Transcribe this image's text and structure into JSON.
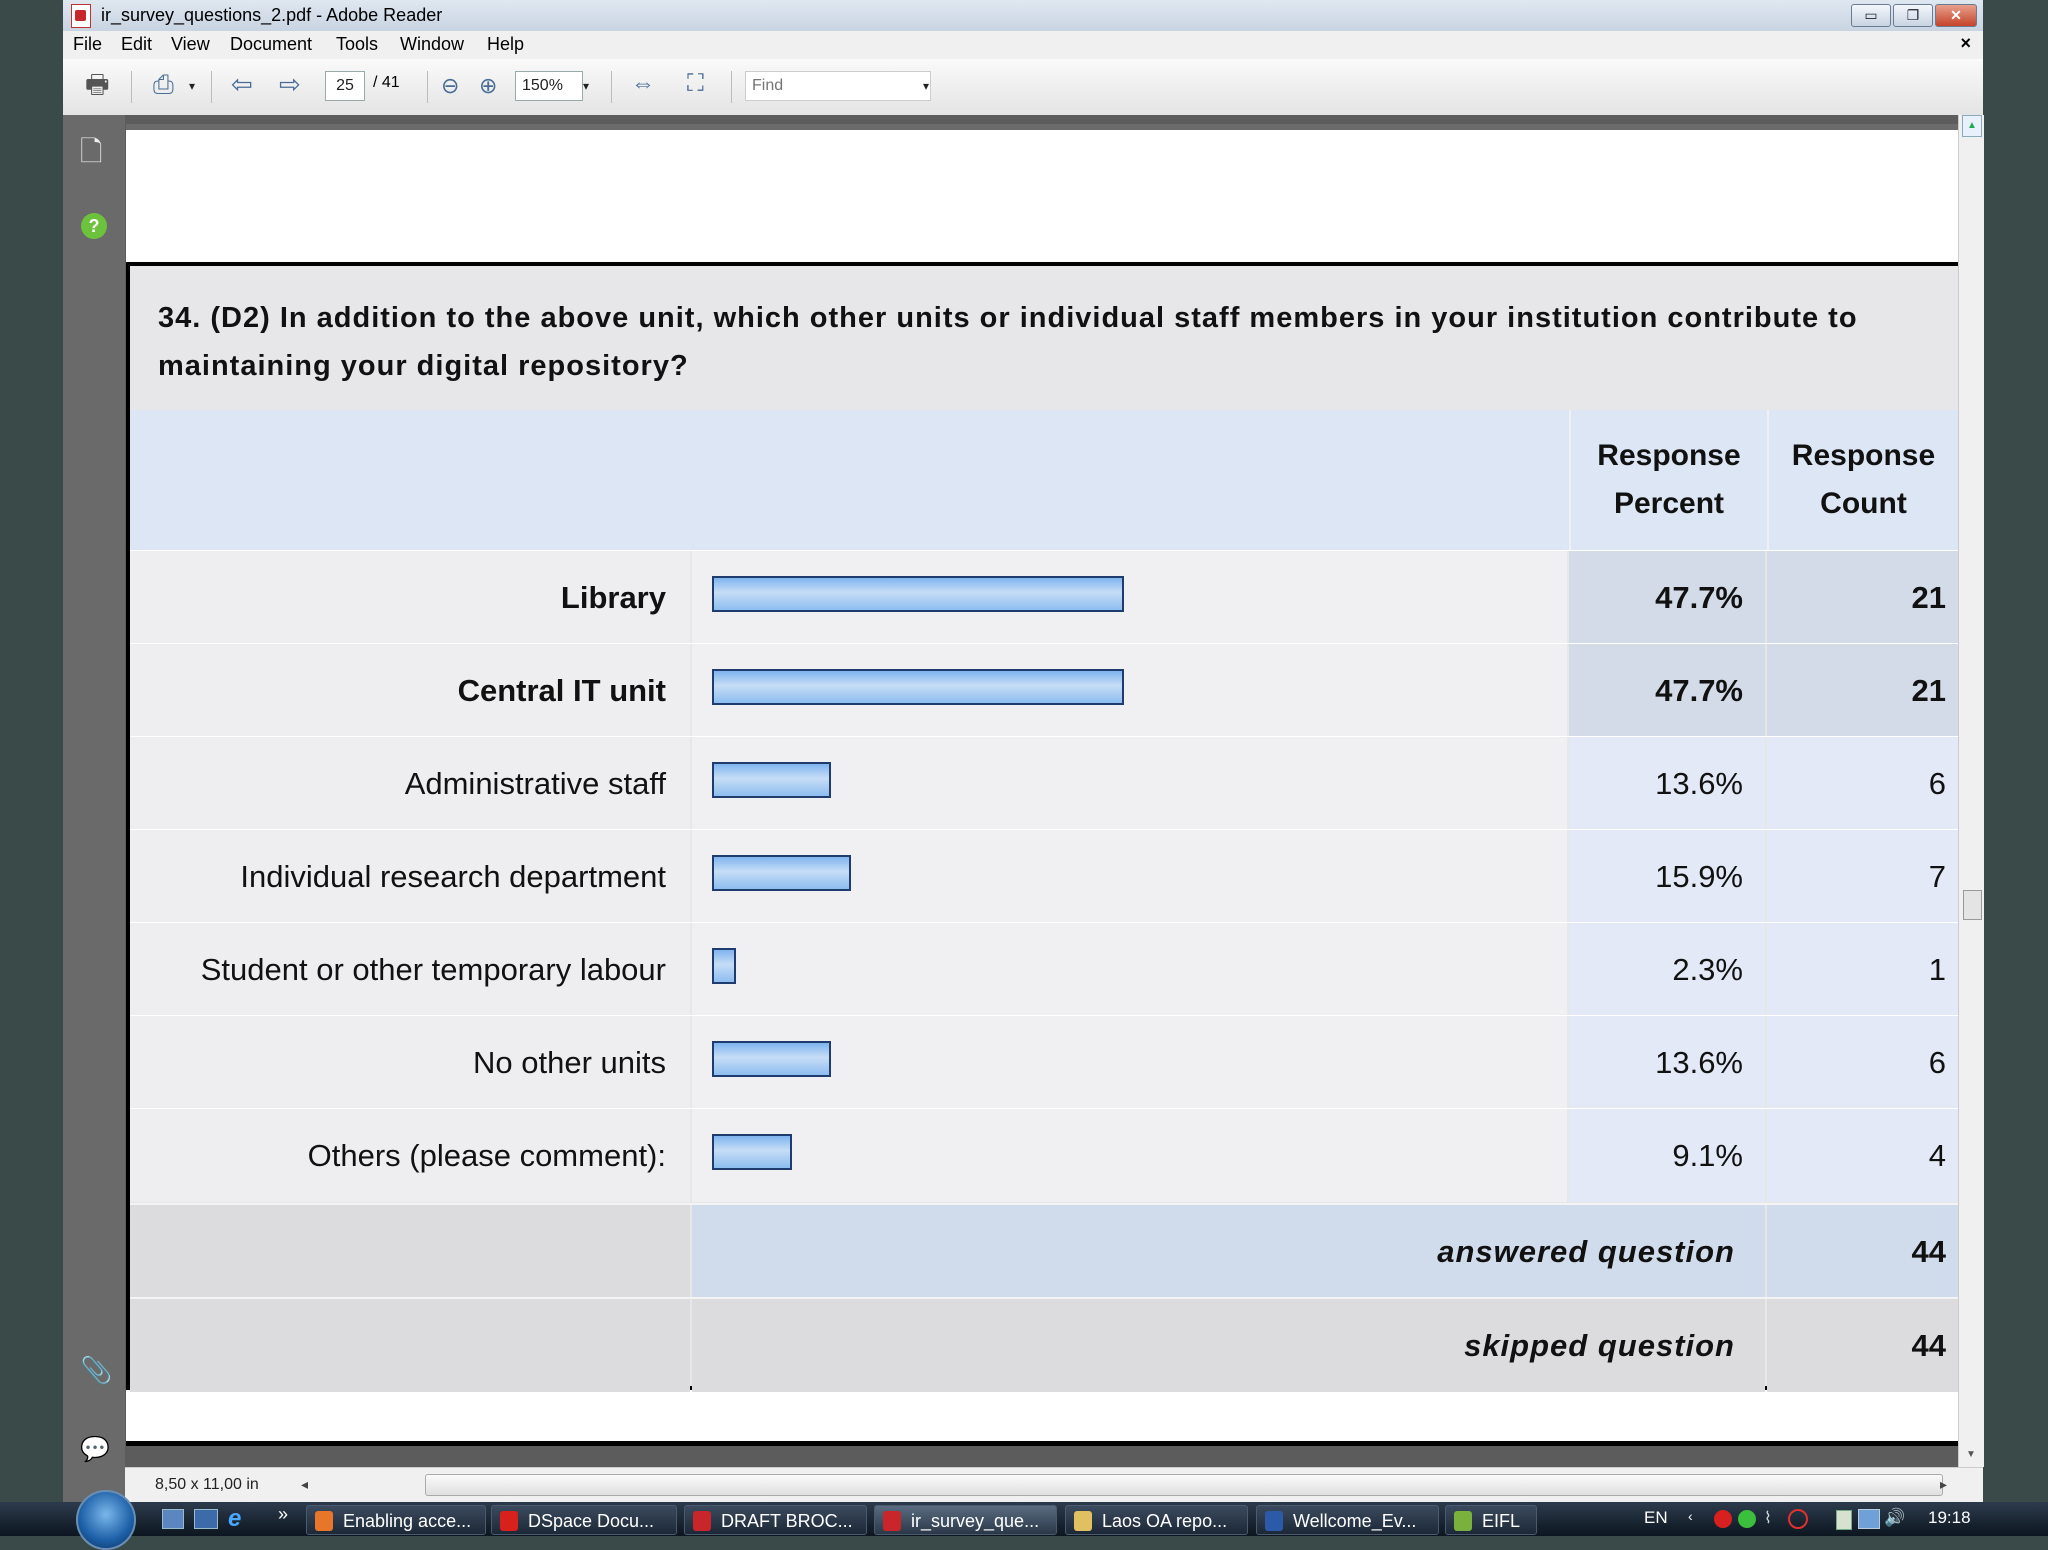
{
  "window": {
    "title": "ir_survey_questions_2.pdf - Adobe Reader",
    "minimize": "▭",
    "restore": "❐",
    "close": "✕"
  },
  "menu": [
    "File",
    "Edit",
    "View",
    "Document",
    "Tools",
    "Window",
    "Help"
  ],
  "menu_close": "×",
  "toolbar": {
    "page_current": "25",
    "page_total": "/ 41",
    "zoom": "150%",
    "find_placeholder": "Find"
  },
  "status": {
    "page_size": "8,50 x 11,00 in"
  },
  "question": "34. (D2) In addition to the above unit, which other units or individual staff members in your institution contribute to maintaining your digital repository?",
  "table": {
    "header_percent": "Response Percent",
    "header_count": "Response Count",
    "rows": [
      {
        "label": "Library",
        "percent": "47.7%",
        "count": "21",
        "bold": true
      },
      {
        "label": "Central IT unit",
        "percent": "47.7%",
        "count": "21",
        "bold": true
      },
      {
        "label": "Administrative staff",
        "percent": "13.6%",
        "count": "6",
        "bold": false
      },
      {
        "label": "Individual research department",
        "percent": "15.9%",
        "count": "7",
        "bold": false
      },
      {
        "label": "Student or other temporary labour",
        "percent": "2.3%",
        "count": "1",
        "bold": false
      },
      {
        "label": "No other units",
        "percent": "13.6%",
        "count": "6",
        "bold": false
      },
      {
        "label": "Others (please comment):",
        "percent": "9.1%",
        "count": "4",
        "bold": false
      }
    ],
    "answered_label": "answered question",
    "answered_count": "44",
    "skipped_label": "skipped question",
    "skipped_count": "44"
  },
  "chart_data": {
    "type": "bar",
    "categories": [
      "Library",
      "Central IT unit",
      "Administrative staff",
      "Individual research department",
      "Student or other temporary labour",
      "No other units",
      "Others (please comment):"
    ],
    "values": [
      47.7,
      47.7,
      13.6,
      15.9,
      2.3,
      13.6,
      9.1
    ],
    "counts": [
      21,
      21,
      6,
      7,
      1,
      6,
      4
    ],
    "orientation": "horizontal",
    "title": "34. (D2) In addition to the above unit, which other units or individual staff members in your institution contribute to maintaining your digital repository?",
    "xlim": [
      0,
      100
    ]
  },
  "taskbar": {
    "buttons": [
      {
        "label": "Enabling acce...",
        "icon": "firefox-icon",
        "color": "#e8762a"
      },
      {
        "label": "DSpace Docu...",
        "icon": "opera-icon",
        "color": "#d8201c"
      },
      {
        "label": "DRAFT BROC...",
        "icon": "pdf-icon",
        "color": "#c8262a"
      },
      {
        "label": "ir_survey_que...",
        "icon": "pdf-icon",
        "color": "#c8262a",
        "active": true
      },
      {
        "label": "Laos OA repo...",
        "icon": "folder-icon",
        "color": "#e0c060"
      },
      {
        "label": "Wellcome_Ev...",
        "icon": "word-icon",
        "color": "#2b5aa8"
      },
      {
        "label": "EIFL",
        "icon": "folder-icon",
        "color": "#7ab03c"
      }
    ],
    "lang": "EN",
    "clock": "19:18",
    "quicklaunch_more": "»"
  }
}
